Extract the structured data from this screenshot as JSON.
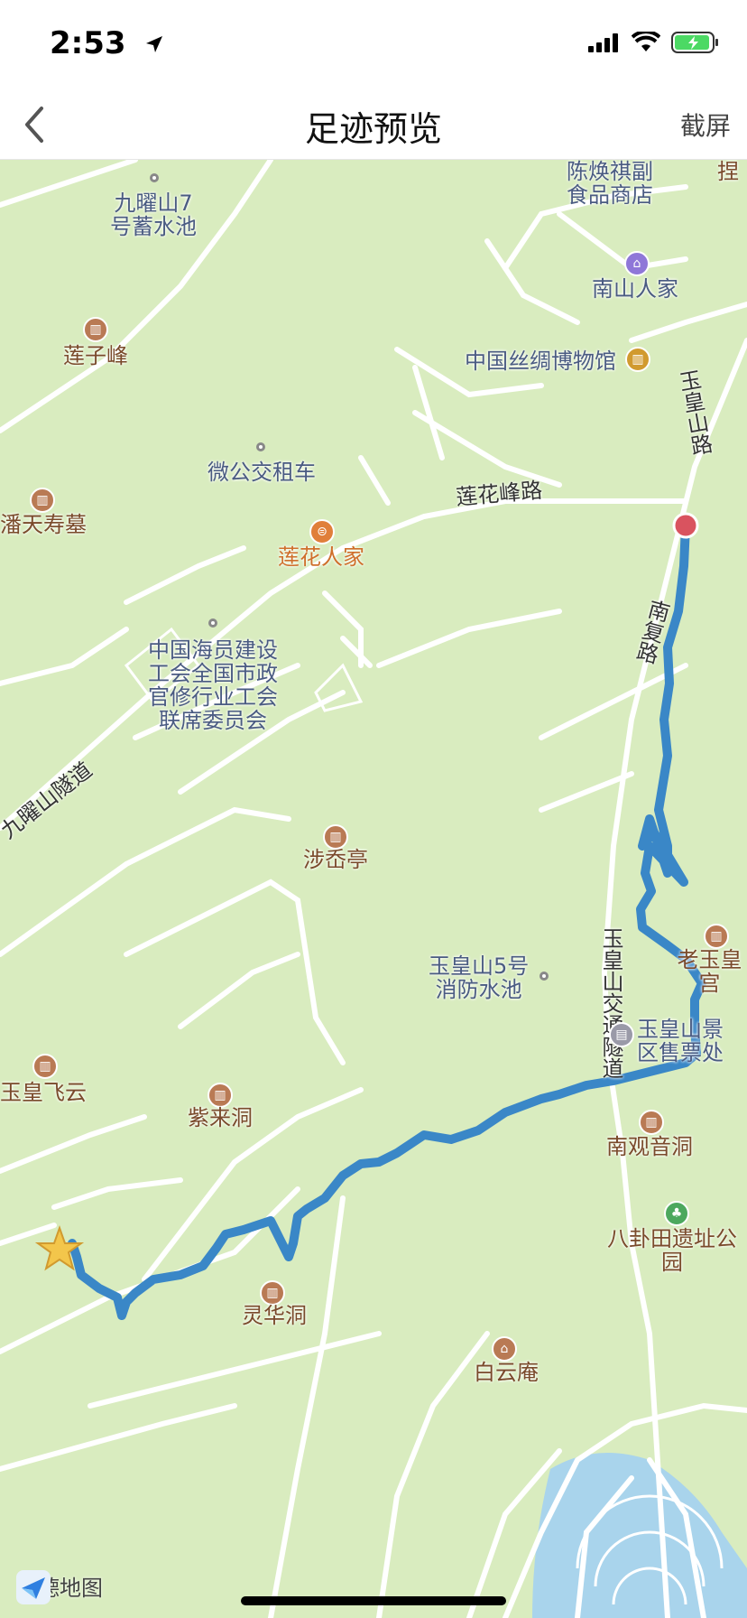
{
  "status_bar": {
    "time": "2:53"
  },
  "nav": {
    "title": "足迹预览",
    "screenshot_label": "截屏"
  },
  "map": {
    "roads": {
      "yuhuangshan_road": "玉皇山路",
      "lianhuafeng_road": "莲花峰路",
      "nanfu_road": "南复路",
      "jiuyaoshan_tunnel": "九曜山隧道",
      "yuhuangshan_tunnel": "玉皇山交通隧道"
    },
    "pois": {
      "chen_shop": "陈焕祺副\n食品商店",
      "tuo": "捏",
      "jiuyao_pool": "九曜山7\n号蓄水池",
      "nanshan_renjia": "南山人家",
      "lianzi_feng": "莲子峰",
      "silk_museum": "中国丝绸博物馆",
      "wei_bus": "微公交租车",
      "pan_tomb": "潘天寿墓",
      "lianhua_renjia": "莲花人家",
      "seamen_union": "中国海员建设\n工会全国市政\n官修行业工会\n联席委员会",
      "shegu_ting": "涉岙亭",
      "lao_yuhuang": "老玉皇宫",
      "fire_pool": "玉皇山5号\n消防水池",
      "ticket_office": "玉皇山景\n区售票处",
      "yuhuang_feiyun": "玉皇飞云",
      "zilai_dong": "紫来洞",
      "nanguan_yindong": "南观音洞",
      "bagua_park": "八卦田遗址公园",
      "linghua_dong": "灵华洞",
      "baiyun_an": "白云庵"
    },
    "brand": "高德地图",
    "colors": {
      "land": "#d9ecbf",
      "road": "#ffffff",
      "track": "#3a87c7",
      "start": "#d9535f",
      "end": "#f3c64b",
      "water": "#a9d4ec"
    }
  }
}
